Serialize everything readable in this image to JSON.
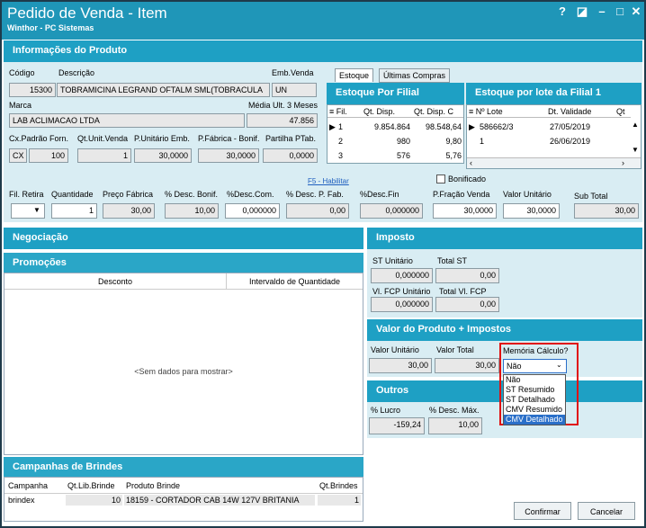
{
  "window": {
    "title": "Pedido de Venda - Item",
    "subtitle": "Winthor - PC Sistemas"
  },
  "product": {
    "header": "Informações do Produto",
    "codigo_label": "Código",
    "codigo": "15300",
    "descricao_label": "Descrição",
    "descricao": "TOBRAMICINA LEGRAND OFTALM SML(TOBRACULA",
    "emb_label": "Emb.Venda",
    "emb": "UN",
    "marca_label": "Marca",
    "marca": "LAB ACLIMACAO LTDA",
    "media_label": "Média Ult. 3 Meses",
    "media": "47.856",
    "cx_label": "Cx.Padrão Forn.",
    "cx_unit": "CX",
    "cx_value": "100",
    "qtunit_label": "Qt.Unit.Venda",
    "qtunit": "1",
    "punit_label": "P.Unitário Emb.",
    "punit": "30,0000",
    "pfab_label": "P.Fábrica - Bonif.",
    "pfab": "30,0000",
    "partilha_label": "Partilha PTab.",
    "partilha": "0,0000"
  },
  "tabs": [
    "Estoque",
    "Últimas Compras"
  ],
  "estoque_filial": {
    "title": "Estoque Por Filial",
    "columns": [
      "Fil.",
      "Qt. Disp.",
      "Qt. Disp. C"
    ],
    "rows": [
      [
        "1",
        "9.854.864",
        "98.548,64"
      ],
      [
        "2",
        "980",
        "9,80"
      ],
      [
        "3",
        "576",
        "5,76"
      ]
    ]
  },
  "estoque_lote": {
    "title": "Estoque por lote da Filial 1",
    "columns": [
      "Nº Lote",
      "Dt. Validade",
      "Qt"
    ],
    "rows": [
      [
        "586662/3",
        "27/05/2019"
      ],
      [
        "1",
        "26/06/2019"
      ],
      [
        "",
        ""
      ]
    ]
  },
  "fs_link": "F5 - Habilitar",
  "bonificado_label": "Bonificado",
  "pricing": {
    "filretira_label": "Fil. Retira",
    "quantidade_label": "Quantidade",
    "quantidade": "1",
    "precofab_label": "Preço Fábrica",
    "precofab": "30,00",
    "descbonif_label": "% Desc. Bonif.",
    "descbonif": "10,00",
    "desccom_label": "%Desc.Com.",
    "desccom": "0,000000",
    "descpfab_label": "% Desc. P. Fab.",
    "descpfab": "0,00",
    "descfin_label": "%Desc.Fin",
    "descfin": "0,000000",
    "pfracao_label": "P.Fração Venda",
    "pfracao": "30,0000",
    "valorunit_label": "Valor Unitário",
    "valorunit": "30,0000",
    "subtotal_label": "Sub Total",
    "subtotal": "30,00"
  },
  "negociacao": "Negociação",
  "promocoes": {
    "title": "Promoções",
    "columns": [
      "Desconto",
      "Intervaldo de Quantidade"
    ],
    "empty": "<Sem dados para mostrar>"
  },
  "imposto": {
    "title": "Imposto",
    "st_unit_label": "ST Unitário",
    "st_unit": "0,000000",
    "total_st_label": "Total ST",
    "total_st": "0,00",
    "fcp_unit_label": "Vl. FCP Unitário",
    "fcp_unit": "0,000000",
    "total_fcp_label": "Total Vl. FCP",
    "total_fcp": "0,00"
  },
  "valor_produto": {
    "title": "Valor do Produto + Impostos",
    "valor_unit_label": "Valor Unitário",
    "valor_unit": "30,00",
    "valor_total_label": "Valor Total",
    "valor_total": "30,00",
    "memoria_label": "Memória Cálculo?",
    "memoria_value": "Não",
    "memoria_options": [
      "Não",
      "ST Resumido",
      "ST Detalhado",
      "CMV Resumido",
      "CMV Detalhado"
    ]
  },
  "outros": {
    "title": "Outros",
    "lucro_label": "% Lucro",
    "lucro": "-159,24",
    "descmax_label": "% Desc. Máx.",
    "descmax": "10,00"
  },
  "campanhas": {
    "title": "Campanhas de Brindes",
    "columns": [
      "Campanha",
      "Qt.Lib.Brinde",
      "Produto Brinde",
      "Qt.Brindes"
    ],
    "row": [
      "brindex",
      "10",
      "18159 - CORTADOR CAB 14W 127V BRITANIA",
      "1"
    ]
  },
  "buttons": {
    "confirmar": "Confirmar",
    "cancelar": "Cancelar"
  }
}
